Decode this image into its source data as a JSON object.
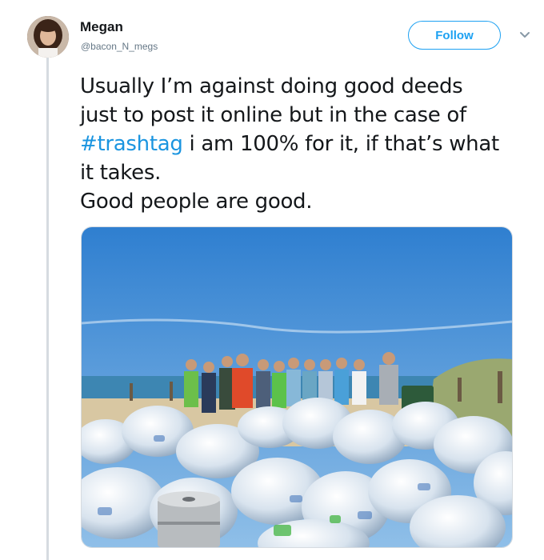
{
  "user": {
    "name": "Megan",
    "handle": "@bacon_N_megs"
  },
  "follow_label": "Follow",
  "tweet": {
    "line1": "Usually I’m against doing good deeds",
    "line2": "just to post it online but in the case of",
    "hashtag": "#trashtag",
    "line3_rest": " i am 100% for it, if that’s what",
    "line4": "it takes.",
    "line5": "Good people are good."
  },
  "colors": {
    "accent": "#1da1f2",
    "hashtag": "#1b95e0",
    "text": "#14171a",
    "muted": "#657786"
  },
  "icons": {
    "more": "chevron-down-icon"
  }
}
